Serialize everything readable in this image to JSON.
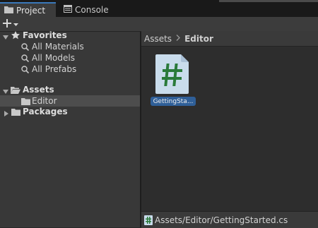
{
  "tabs": [
    {
      "label": "Project",
      "icon": "folder-icon",
      "active": true
    },
    {
      "label": "Console",
      "icon": "console-icon",
      "active": false
    }
  ],
  "toolbar": {
    "add_icon": "plus-dropdown-icon"
  },
  "sidebar": {
    "favorites": {
      "label": "Favorites",
      "items": [
        {
          "label": "All Materials",
          "icon": "search-icon"
        },
        {
          "label": "All Models",
          "icon": "search-icon"
        },
        {
          "label": "All Prefabs",
          "icon": "search-icon"
        }
      ]
    },
    "assets": {
      "label": "Assets",
      "children": [
        {
          "label": "Editor",
          "selected": true
        }
      ]
    },
    "packages": {
      "label": "Packages"
    }
  },
  "breadcrumb": {
    "root": "Assets",
    "current": "Editor"
  },
  "files": [
    {
      "name": "GettingSta...",
      "icon": "csharp-script-icon",
      "selected": true
    }
  ],
  "status": {
    "path": "Assets/Editor/GettingStarted.cs"
  },
  "colors": {
    "accent": "#3a79bb",
    "selection": "#2f5f98",
    "script_green": "#2a7a3a"
  }
}
